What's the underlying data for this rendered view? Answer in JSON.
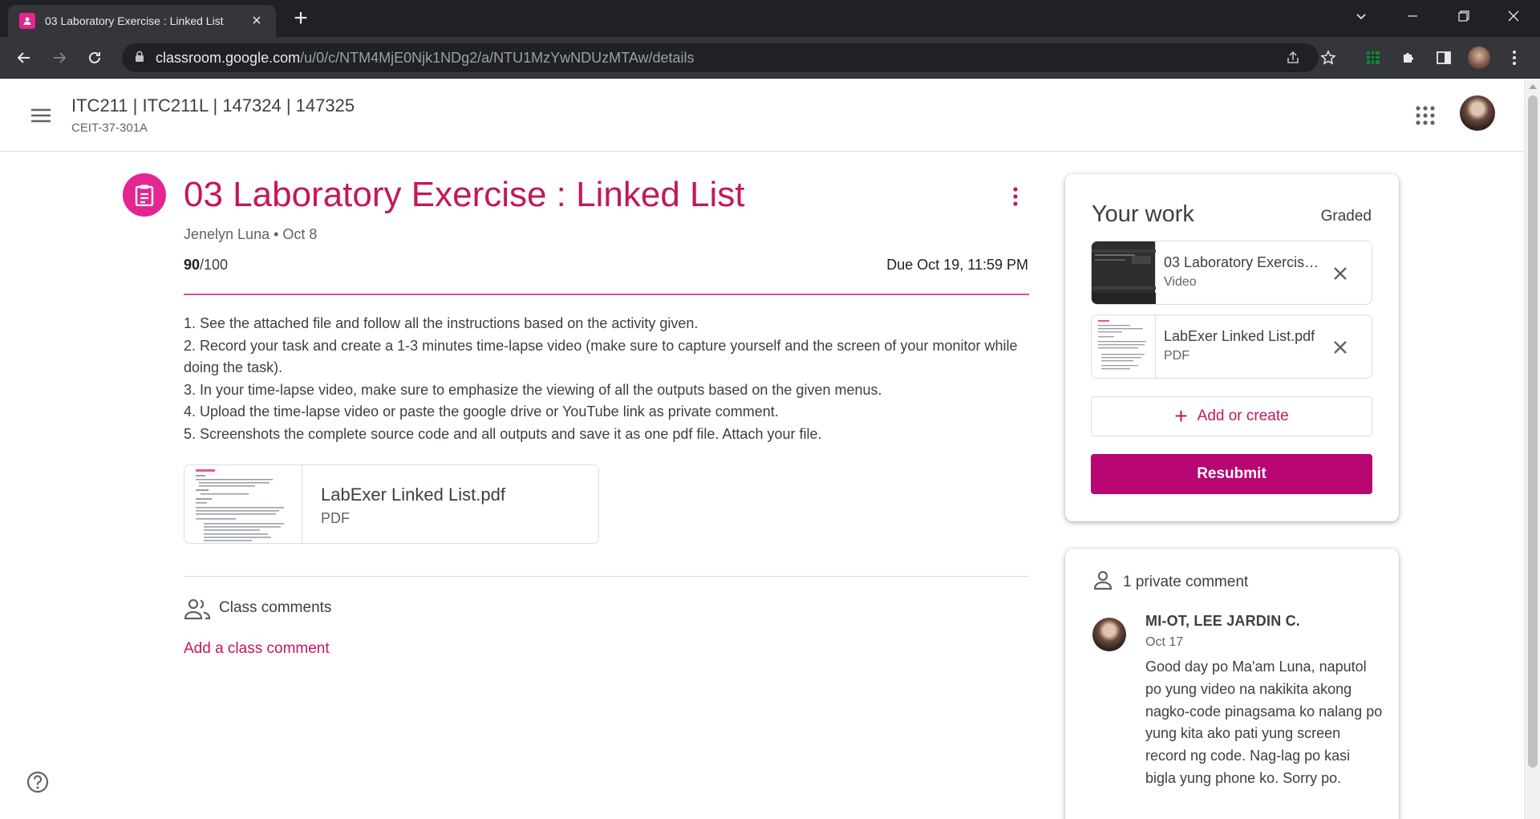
{
  "browser": {
    "tab_title": "03 Laboratory Exercise : Linked List",
    "url_host": "classroom.google.com",
    "url_path": "/u/0/c/NTM4MjE0Njk1NDg2/a/NTU1MzYwNDUzMTAw/details"
  },
  "header": {
    "class_title": "ITC211 | ITC211L | 147324 | 147325",
    "class_section": "CEIT-37-301A"
  },
  "assignment": {
    "title": "03 Laboratory Exercise : Linked List",
    "meta": "Jenelyn Luna • Oct 8",
    "points_earned": "90",
    "points_total": "/100",
    "due": "Due Oct 19, 11:59 PM",
    "instructions": [
      "1. See the attached file and follow all the instructions based on the activity given.",
      "2. Record your task and create a 1-3 minutes time-lapse video (make sure to capture yourself and the screen of your monitor while doing the task).",
      "3. In your time-lapse video, make sure to emphasize the viewing of all the outputs based on the given menus.",
      "4. Upload the time-lapse video or paste the google drive or YouTube link as private comment.",
      "5. Screenshots the complete source code and all outputs and save it as one pdf file. Attach your file."
    ],
    "attachment": {
      "name": "LabExer Linked List.pdf",
      "type": "PDF"
    }
  },
  "class_comments": {
    "label": "Class comments",
    "add_label": "Add a class comment"
  },
  "your_work": {
    "title": "Your work",
    "status": "Graded",
    "items": [
      {
        "name": "03 Laboratory Exercise : Linked List",
        "type": "Video"
      },
      {
        "name": "LabExer Linked List.pdf",
        "type": "PDF"
      }
    ],
    "add_label": "Add or create",
    "resubmit_label": "Resubmit"
  },
  "private_comments": {
    "header": "1 private comment",
    "author": "MI-OT, LEE JARDIN C.",
    "date": "Oct 17",
    "text": "Good day po Ma'am Luna, naputol po yung video na nakikita akong nagko-code pinagsama ko nalang po yung kita ako pati yung screen record ng code. Nag-lag po kasi bigla yung phone ko. Sorry po."
  },
  "colors": {
    "accent": "#e52592",
    "title_pink": "#c2185b",
    "button": "#b80672"
  }
}
